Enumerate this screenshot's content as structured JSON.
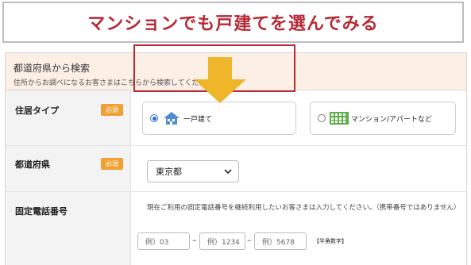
{
  "banner": {
    "text": "マンションでも戸建てを選んでみる"
  },
  "section": {
    "title": "都道府県から検索",
    "subtitle": "住所からお調べになるお客さまはこちらから検索してください"
  },
  "required_badge": "必須",
  "housing": {
    "label": "住居タイプ",
    "options": [
      {
        "label": "一戸建て",
        "selected": true,
        "icon": "house-icon"
      },
      {
        "label": "マンション/アパートなど",
        "selected": false,
        "icon": "apartment-icon"
      }
    ]
  },
  "prefecture": {
    "label": "都道府県",
    "value": "東京都"
  },
  "phone": {
    "label": "固定電話番号",
    "note": "現在ご利用の固定電話番号を継続利用したいお客さまは入力してください。（携帯番号ではありません）",
    "placeholders": [
      "例）03",
      "例）1234",
      "例）5678"
    ],
    "separator": "–",
    "hint": "【半角数字】"
  },
  "colors": {
    "accent": "#b52a36",
    "badge": "#f0a136",
    "arrow": "#efb62c",
    "radio": "#2c6ed5"
  }
}
